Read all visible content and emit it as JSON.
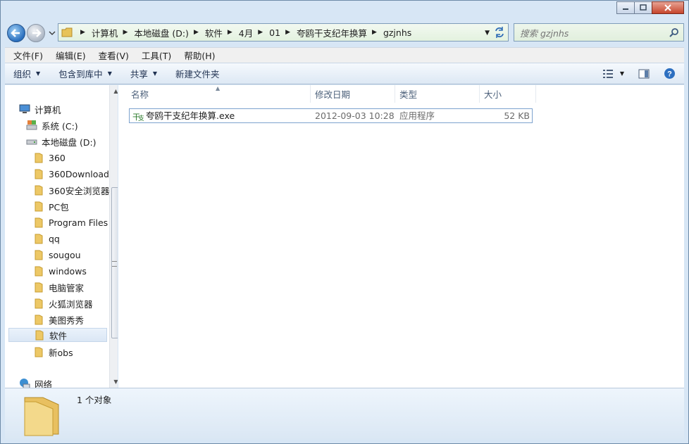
{
  "address": {
    "crumbs": [
      "计算机",
      "本地磁盘 (D:)",
      "软件",
      "4月",
      "01",
      "夸鸥干支纪年换算",
      "gzjnhs"
    ]
  },
  "search": {
    "placeholder": "搜索 gzjnhs"
  },
  "menu": [
    {
      "label": "文件(F)",
      "name": "menu-file"
    },
    {
      "label": "编辑(E)",
      "name": "menu-edit"
    },
    {
      "label": "查看(V)",
      "name": "menu-view"
    },
    {
      "label": "工具(T)",
      "name": "menu-tools"
    },
    {
      "label": "帮助(H)",
      "name": "menu-help"
    }
  ],
  "toolbar": {
    "organize": "组织",
    "include_library": "包含到库中",
    "share": "共享",
    "new_folder": "新建文件夹"
  },
  "tree": {
    "computer": "计算机",
    "drive_c": "系统 (C:)",
    "drive_d": "本地磁盘 (D:)",
    "folders": [
      "360",
      "360Download",
      "360安全浏览器",
      "PC包",
      "Program Files",
      "qq",
      "sougou",
      "windows",
      "电脑管家",
      "火狐浏览器",
      "美图秀秀",
      "软件",
      "新obs"
    ],
    "selected_folder": "软件",
    "network": "网络"
  },
  "columns": {
    "name": "名称",
    "modified": "修改日期",
    "type": "类型",
    "size": "大小"
  },
  "files": [
    {
      "name": "夸鸥干支纪年换算.exe",
      "modified": "2012-09-03 10:28",
      "type": "应用程序",
      "size": "52 KB"
    }
  ],
  "details": {
    "count": "1 个对象"
  },
  "colors": {
    "address_bg": "#e3f2df",
    "selection_border": "#7da2ce",
    "toolbar_bg": "#dde8f4"
  }
}
